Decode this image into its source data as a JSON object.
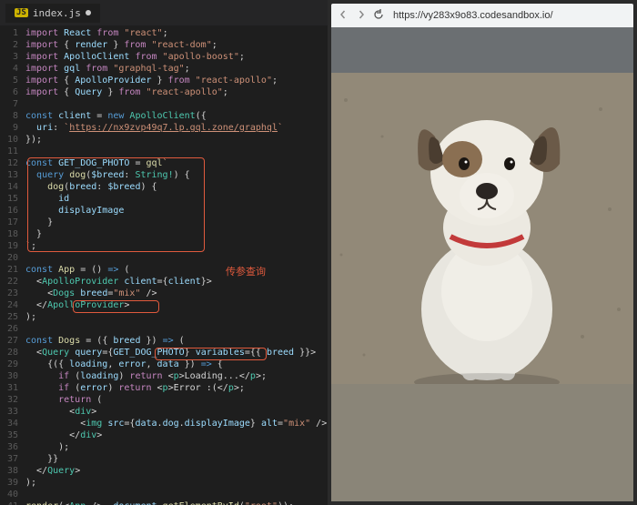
{
  "tab": {
    "icon_label": "JS",
    "filename": "index.js"
  },
  "browser": {
    "url": "https://vy283x9o83.codesandbox.io/"
  },
  "annotation": "传参查询",
  "lines": [
    {
      "n": 1,
      "html": "<span class='k-import'>import</span> <span class='var'>React</span> <span class='k-from'>from</span> <span class='str'>\"react\"</span>;"
    },
    {
      "n": 2,
      "html": "<span class='k-import'>import</span> { <span class='var'>render</span> } <span class='k-from'>from</span> <span class='str'>\"react-dom\"</span>;"
    },
    {
      "n": 3,
      "html": "<span class='k-import'>import</span> <span class='var'>ApolloClient</span> <span class='k-from'>from</span> <span class='str'>\"apollo-boost\"</span>;"
    },
    {
      "n": 4,
      "html": "<span class='k-import'>import</span> <span class='var'>gql</span> <span class='k-from'>from</span> <span class='str'>\"graphql-tag\"</span>;"
    },
    {
      "n": 5,
      "html": "<span class='k-import'>import</span> { <span class='var'>ApolloProvider</span> } <span class='k-from'>from</span> <span class='str'>\"react-apollo\"</span>;"
    },
    {
      "n": 6,
      "html": "<span class='k-import'>import</span> { <span class='var'>Query</span> } <span class='k-from'>from</span> <span class='str'>\"react-apollo\"</span>;"
    },
    {
      "n": 7,
      "html": ""
    },
    {
      "n": 8,
      "html": "<span class='k-const'>const</span> <span class='var'>client</span> = <span class='k-new'>new</span> <span class='type'>ApolloClient</span>({"
    },
    {
      "n": 9,
      "html": "  <span class='prop'>uri</span>: <span class='str'>`<span class='underline'>https://nx9zvp49q7.lp.gql.zone/graphql</span>`</span>"
    },
    {
      "n": 10,
      "html": "});"
    },
    {
      "n": 11,
      "html": ""
    },
    {
      "n": 12,
      "html": "<span class='k-const'>const</span> <span class='var'>GET_DOG_PHOTO</span> = <span class='fn'>gql</span><span class='str'>`</span>"
    },
    {
      "n": 13,
      "html": "  <span class='gql-kw'>query</span> <span class='fn'>dog</span>(<span class='var'>$breed</span>: <span class='type'>String!</span>) {"
    },
    {
      "n": 14,
      "html": "    <span class='fn'>dog</span>(<span class='var'>breed</span>: <span class='var'>$breed</span>) {"
    },
    {
      "n": 15,
      "html": "      <span class='prop'>id</span>"
    },
    {
      "n": 16,
      "html": "      <span class='prop'>displayImage</span>"
    },
    {
      "n": 17,
      "html": "    }"
    },
    {
      "n": 18,
      "html": "  }"
    },
    {
      "n": 19,
      "html": "<span class='str'>`</span>;"
    },
    {
      "n": 20,
      "html": ""
    },
    {
      "n": 21,
      "html": "<span class='k-const'>const</span> <span class='fn'>App</span> = () <span class='k-const'>=></span> ("
    },
    {
      "n": 22,
      "html": "  &lt;<span class='jsx-tag'>ApolloProvider</span> <span class='jsx-attr'>client</span>={<span class='var'>client</span>}&gt;"
    },
    {
      "n": 23,
      "html": "    &lt;<span class='jsx-tag'>Dogs</span> <span class='jsx-attr'>breed</span>=<span class='str'>\"mix\"</span> /&gt;"
    },
    {
      "n": 24,
      "html": "  &lt;/<span class='jsx-tag'>ApolloProvider</span>&gt;"
    },
    {
      "n": 25,
      "html": ");"
    },
    {
      "n": 26,
      "html": ""
    },
    {
      "n": 27,
      "html": "<span class='k-const'>const</span> <span class='fn'>Dogs</span> = ({ <span class='var'>breed</span> }) <span class='k-const'>=></span> ("
    },
    {
      "n": 28,
      "html": "  &lt;<span class='jsx-tag'>Query</span> <span class='jsx-attr'>query</span>={<span class='var'>GET_DOG_PHOTO</span>} <span class='jsx-attr'>variables</span>={{ <span class='var'>breed</span> }}&gt;"
    },
    {
      "n": 29,
      "html": "    {({ <span class='var'>loading</span>, <span class='var'>error</span>, <span class='var'>data</span> }) <span class='k-const'>=></span> {"
    },
    {
      "n": 30,
      "html": "      <span class='k-if'>if</span> (<span class='var'>loading</span>) <span class='k-return'>return</span> &lt;<span class='jsx-tag'>p</span>&gt;Loading...&lt;/<span class='jsx-tag'>p</span>&gt;;"
    },
    {
      "n": 31,
      "html": "      <span class='k-if'>if</span> (<span class='var'>error</span>) <span class='k-return'>return</span> &lt;<span class='jsx-tag'>p</span>&gt;Error :(&lt;/<span class='jsx-tag'>p</span>&gt;;"
    },
    {
      "n": 32,
      "html": "      <span class='k-return'>return</span> ("
    },
    {
      "n": 33,
      "html": "        &lt;<span class='jsx-tag'>div</span>&gt;"
    },
    {
      "n": 34,
      "html": "          &lt;<span class='jsx-tag'>img</span> <span class='jsx-attr'>src</span>={<span class='var'>data</span>.<span class='prop'>dog</span>.<span class='prop'>displayImage</span>} <span class='jsx-attr'>alt</span>=<span class='str'>\"mix\"</span> /&gt;"
    },
    {
      "n": 35,
      "html": "        &lt;/<span class='jsx-tag'>div</span>&gt;"
    },
    {
      "n": 36,
      "html": "      );"
    },
    {
      "n": 37,
      "html": "    }}"
    },
    {
      "n": 38,
      "html": "  &lt;/<span class='jsx-tag'>Query</span>&gt;"
    },
    {
      "n": 39,
      "html": ");"
    },
    {
      "n": 40,
      "html": ""
    },
    {
      "n": 41,
      "html": "<span class='fn'>render</span>(&lt;<span class='jsx-tag'>App</span> /&gt;, <span class='var'>document</span>.<span class='fn'>getElementById</span>(<span class='str'>\"root\"</span>));"
    }
  ]
}
